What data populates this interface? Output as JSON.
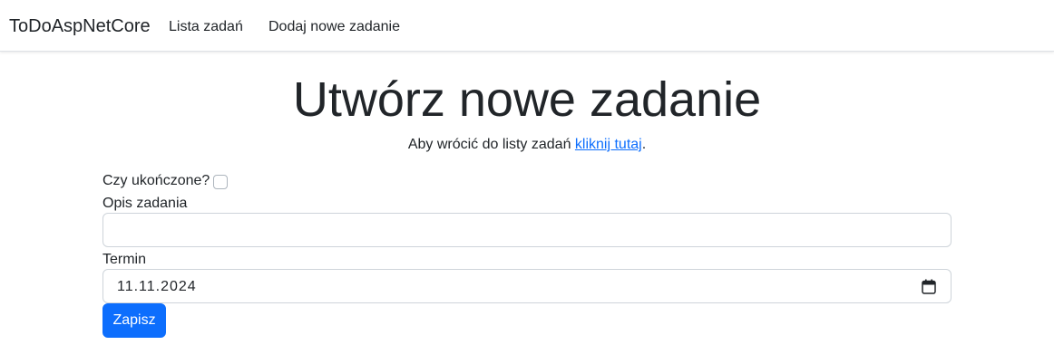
{
  "navbar": {
    "brand": "ToDoAspNetCore",
    "links": [
      "Lista zadań",
      "Dodaj nowe zadanie"
    ]
  },
  "main": {
    "title": "Utwórz nowe zadanie",
    "subtitle_before": "Aby wrócić do listy zadań ",
    "subtitle_link": "kliknij tutaj",
    "subtitle_after": "."
  },
  "form": {
    "completed_label": "Czy ukończone?",
    "completed_checked": false,
    "description_label": "Opis zadania",
    "description_value": "",
    "deadline_label": "Termin",
    "deadline_value": "11.11.2024",
    "calendar_icon": "calendar-icon",
    "submit_label": "Zapisz"
  },
  "colors": {
    "accent": "#0d6efd",
    "text": "#212529",
    "border": "#ced4da"
  }
}
